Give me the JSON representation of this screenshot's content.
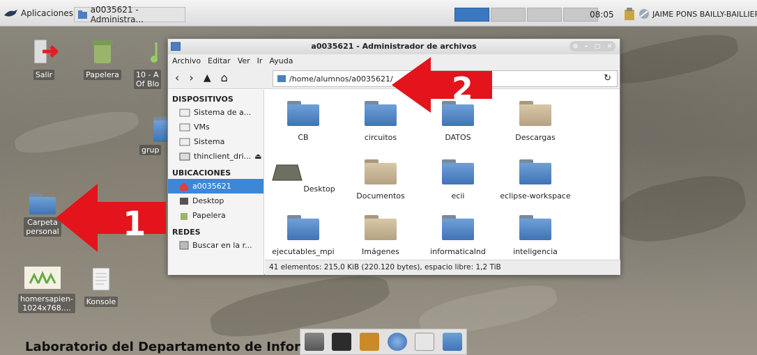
{
  "panel": {
    "apps_label": "Aplicaciones",
    "task_label": "a0035621 - Administra...",
    "clock": "08:05",
    "user": "JAIME PONS BAILLY-BAILLIER"
  },
  "desktop": {
    "icons": [
      {
        "label": "Salir"
      },
      {
        "label": "Papelera"
      },
      {
        "label": "10 - A\nOf Blo"
      },
      {
        "label": "grup"
      },
      {
        "label": "Carpeta\npersonal"
      },
      {
        "label": "homersapien-\n1024x768...."
      },
      {
        "label": "Konsole"
      }
    ],
    "lab_title": "Laboratorio del Departamento de Infor"
  },
  "window": {
    "title": "a0035621 - Administrador de archivos",
    "menu": [
      "Archivo",
      "Editar",
      "Ver",
      "Ir",
      "Ayuda"
    ],
    "address": "/home/alumnos/a0035621/",
    "sidebar": {
      "dispositivos_header": "DISPOSITIVOS",
      "dispositivos": [
        "Sistema de a...",
        "VMs",
        "Sistema",
        "thinclient_dri..."
      ],
      "ubicaciones_header": "UBICACIONES",
      "ubicaciones": [
        "a0035621",
        "Desktop",
        "Papelera"
      ],
      "redes_header": "REDES",
      "redes": [
        "Buscar en la r..."
      ]
    },
    "items": [
      "CB",
      "circuitos",
      "DATOS",
      "Descargas",
      "Desktop",
      "Documentos",
      "ecii",
      "eclipse-workspace",
      "ejecutables_mpi",
      "Imágenes",
      "informaticaInd",
      "inteligencia"
    ],
    "status": "41 elementos: 215,0 KiB (220.120 bytes), espacio libre: 1,2 TiB"
  },
  "annotations": {
    "arrow1_number": "1",
    "arrow2_number": "2",
    "arrow_color": "#e3141b"
  }
}
